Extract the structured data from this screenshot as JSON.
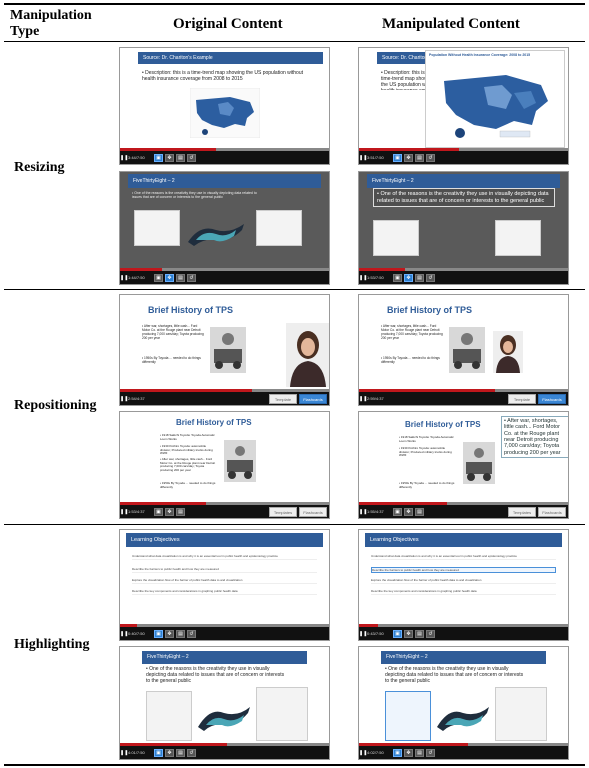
{
  "table": {
    "header_manipulation_type": "Manipulation\nType",
    "header_original": "Original Content",
    "header_manipulated": "Manipulated Content",
    "rows": [
      {
        "label": "Resizing"
      },
      {
        "label": "Repositioning"
      },
      {
        "label": "Highlighting"
      }
    ]
  },
  "tiles": {
    "resize_orig_1": {
      "title": "Source: Dr. Chariton's Example",
      "bullet": "• Description: this is a time-trend map showing the US population without health insurance coverage from 2008 to 2015",
      "time": "3:44/7:50",
      "progress": 0.46
    },
    "resize_manip_1": {
      "title": "Source: Dr. Chariton's Example",
      "bullet": "• Description: this is a time-trend map showing the US population without health insurance coverage from 2008 to 2015",
      "map_title": "Population Without Health Insurance Coverage: 2008 to 2015",
      "time": "3:51/7:50",
      "progress": 0.48
    },
    "resize_orig_2": {
      "title": "FiveThirtyEight – 2",
      "bullet": "• One of the reasons is the creativity they use in visually depicting data related to issues that are of concern or interests to the general public",
      "time": "1:44/7:50",
      "progress": 0.2
    },
    "resize_manip_2": {
      "title": "FiveThirtyEight – 2",
      "bullet": "• One of the reasons is the creativity they use in visually depicting data related to issues that are of concern or interests to the general public",
      "time": "1:53/7:50",
      "progress": 0.22
    },
    "repos_orig_1": {
      "title": "Brief History of TPS",
      "bullet1": "• After war, shortages, little cash... Ford Motor Co. at the Rouge plant near Detroit producing 7,000 cars/day; Toyota producing 200 per year",
      "bullet2": "• 1950s By Toyoda ... needed to do things differently",
      "time": "2:54/4:37",
      "progress": 0.63,
      "btn1": "Template",
      "btn2": "Flashcards"
    },
    "repos_manip_1": {
      "title": "Brief History of TPS",
      "bullet1": "• After war, shortages, little cash... Ford Motor Co. at the Rouge plant near Detroit producing 7,000 cars/day; Toyota producing 200 per year",
      "bullet2": "• 1950s By Toyoda ... needed to do things differently",
      "time": "2:59/4:37",
      "progress": 0.65,
      "btn1": "Template",
      "btn2": "Flashcards"
    },
    "repos_orig_2": {
      "title": "Brief History of TPS",
      "bullets": [
        "• 1918 Sakichi Toyoda: Toyoda Automatic Loom Works",
        "• 1930 Kiichiro Toyoda: automobile division; Produced military trucks during WWII",
        "• After war, shortages, little cash... Ford Motor Co. at the Rouge plant near Detroit producing 7,000 cars/day; Toyota producing 200 per year",
        "• 1950s By Toyoda ... needed to do things differently"
      ],
      "time": "1:53/4:37",
      "progress": 0.41,
      "btn1": "Templates",
      "btn2": "Flashcards"
    },
    "repos_manip_2": {
      "title": "Brief History of TPS",
      "bullets": [
        "• 1918 Sakichi Toyoda: Toyoda Automatic Loom Works",
        "• 1930 Kiichiro Toyoda: automobile division; Produced military trucks during WWII",
        "• 1950s By Toyoda ... needed to do things differently"
      ],
      "callout": "• After war, shortages, little cash... Ford Motor Co. at the Rouge plant near Detroit producing 7,000 cars/day; Toyota producing 200 per year",
      "time": "1:55/4:37",
      "progress": 0.42,
      "btn1": "Templates",
      "btn2": "Flashcards"
    },
    "high_orig_1": {
      "title": "Learning Objectives",
      "items": [
        "Understand what data visualization is and why it is an essential tool in public health and epidemiology practice",
        "Describe the barriers to public health and how they are measured",
        "Explore the visualization flow of the barrier of public health data to and visualization",
        "Describe the key components and considerations in graphing public health data"
      ],
      "time": "0:40/7:50",
      "progress": 0.08
    },
    "high_manip_1": {
      "title": "Learning Objectives",
      "items": [
        "Understand what data visualization is and why it is an essential tool in public health and epidemiology practice",
        "Describe the barriers to public health and how they are measured",
        "Explore the visualization flow of the barrier of public health data to and visualization",
        "Describe the key components and considerations in graphing public health data"
      ],
      "time": "0:43/7:50",
      "progress": 0.09
    },
    "high_orig_2": {
      "title": "FiveThirtyEight – 2",
      "bullet": "• One of the reasons is the creativity they use in visually depicting data related to issues that are of concern or interests to the general public",
      "time": "4:01/7:50",
      "progress": 0.51
    },
    "high_manip_2": {
      "title": "FiveThirtyEight – 2",
      "bullet": "• One of the reasons is the creativity they use in visually depicting data related to issues that are of concern or interests to the general public",
      "time": "4:02/7:50",
      "progress": 0.52
    }
  },
  "colors": {
    "title_bar": "#2f5c98",
    "progress": "#c0171c",
    "highlight": "#4a90d9"
  }
}
